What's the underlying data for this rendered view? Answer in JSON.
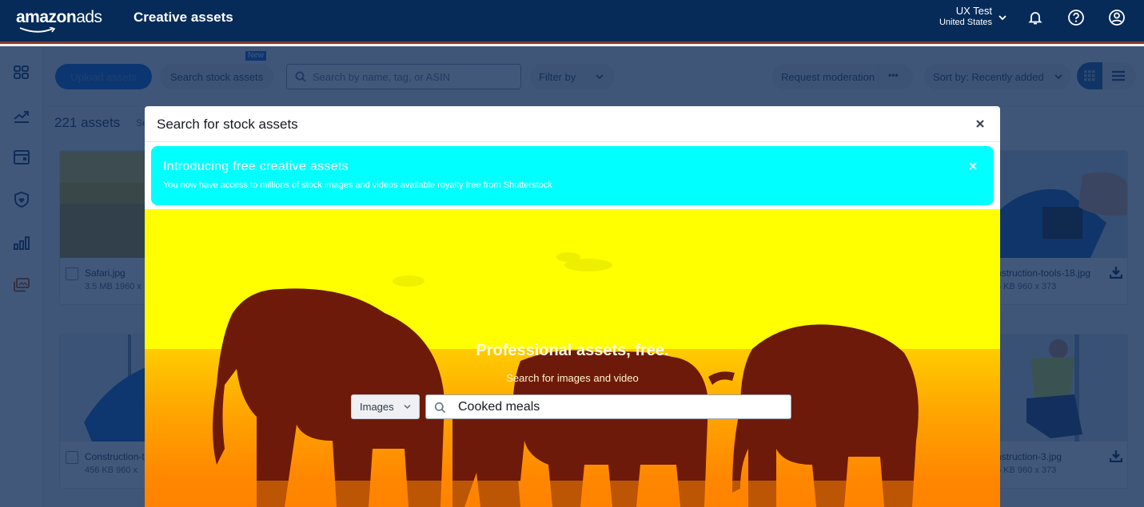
{
  "header": {
    "logo_bold": "amazon",
    "logo_light": "ads",
    "app_title": "Creative assets",
    "account_name": "UX Test",
    "account_country": "United States",
    "icons": [
      "notifications-bell-icon",
      "help-icon",
      "user-profile-icon"
    ]
  },
  "left_nav": {
    "items": [
      {
        "icon": "dashboard-grid-icon"
      },
      {
        "icon": "trending-chart-icon"
      },
      {
        "icon": "campaigns-window-icon"
      },
      {
        "icon": "brand-shield-icon"
      },
      {
        "icon": "reports-bar-chart-icon"
      },
      {
        "icon": "creative-assets-icon",
        "active": true
      }
    ],
    "active_color": "#c45500"
  },
  "toolbar": {
    "upload_label": "Upload assets",
    "stock_label": "Search stock assets",
    "new_badge": "New",
    "search_placeholder": "Search by name, tag, or ASIN",
    "filter_label": "Filter by",
    "moderation_label": "Request moderation",
    "more_label": "•••",
    "sort_label": "Sort by: Recently added",
    "view_modes": [
      "grid",
      "list"
    ],
    "active_view": "grid"
  },
  "assets": {
    "count_label": "221 assets",
    "select_label": "Se",
    "cards": [
      {
        "name": "Safari.jpg",
        "meta": "3.5 MB 1960 x"
      },
      {
        "name": "nstruction-tools-18.jpg",
        "meta": "6 KB 960 x 373"
      },
      {
        "name": "Construction-t",
        "meta": "456 KB 960 x"
      },
      {
        "name": "nstruction-3.jpg",
        "meta": "6 KB 960 x 373"
      }
    ]
  },
  "modal": {
    "title": "Search for stock assets",
    "banner": {
      "title": "Introducing free creative assets",
      "text": "You now have access to millions of stock images and videos available royalty free from Shutterstock",
      "bg_color": "#00ffff"
    },
    "hero": {
      "title": "Professional assets, free.",
      "subtitle": "Search for images and video",
      "type_selected": "Images",
      "search_value": "Cooked meals"
    }
  }
}
